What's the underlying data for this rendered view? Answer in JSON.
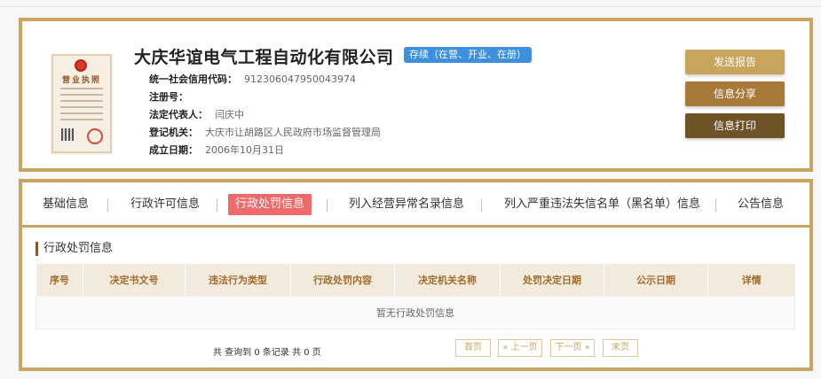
{
  "company": {
    "name": "大庆华谊电气工程自动化有限公司",
    "status": "存续（在营、开业、在册）",
    "license_title": "营业执照",
    "fields": [
      {
        "label": "统一社会信用代码：",
        "value": "912306047950043974"
      },
      {
        "label": "注册号：",
        "value": ""
      },
      {
        "label": "法定代表人：",
        "value": "闫庆中"
      },
      {
        "label": "登记机关：",
        "value": "大庆市让胡路区人民政府市场监督管理局"
      },
      {
        "label": "成立日期：",
        "value": "2006年10月31日"
      }
    ]
  },
  "actions": {
    "report": "发送报告",
    "share": "信息分享",
    "print": "信息打印"
  },
  "tabs": [
    {
      "label": "基础信息",
      "active": false
    },
    {
      "label": "行政许可信息",
      "active": false
    },
    {
      "label": "行政处罚信息",
      "active": true
    },
    {
      "label": "列入经营异常名录信息",
      "active": false
    },
    {
      "label": "列入严重违法失信名单（黑名单）信息",
      "active": false
    },
    {
      "label": "公告信息",
      "active": false
    }
  ],
  "section": {
    "title": "行政处罚信息",
    "columns": [
      "序号",
      "决定书文号",
      "违法行为类型",
      "行政处罚内容",
      "决定机关名称",
      "处罚决定日期",
      "公示日期",
      "详情"
    ],
    "empty_text": "暂无行政处罚信息"
  },
  "pager": {
    "summary": "共 查询到 0 条记录 共 0 页",
    "first": "首页",
    "prev": "« 上一页",
    "next": "下一页 »",
    "last": "末页"
  },
  "colors": {
    "gold": "#c9a45c",
    "brown": "#a87a3a",
    "dark_brown": "#6e5327",
    "active_tab": "#ef6a6a",
    "badge": "#3d8fdf"
  }
}
